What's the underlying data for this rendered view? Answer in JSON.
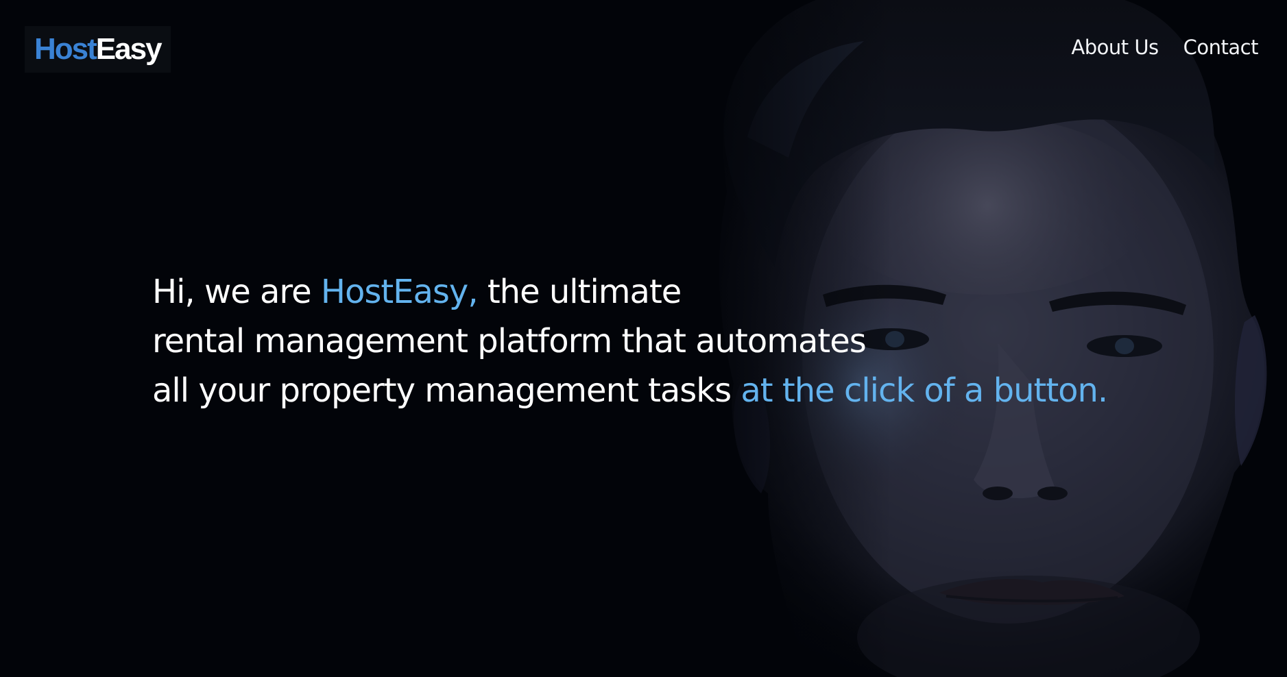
{
  "header": {
    "logo": {
      "part_primary": "Host",
      "part_secondary": "Easy"
    },
    "nav": [
      {
        "label": "About Us"
      },
      {
        "label": "Contact"
      }
    ]
  },
  "hero": {
    "line1": {
      "pre": "Hi, we are ",
      "brand": "HostEasy,",
      "post": " the ultimate"
    },
    "line2": "rental management platform that automates",
    "line3": {
      "pre": "all your property management tasks ",
      "accent": "at the click of a button."
    }
  },
  "colors": {
    "background": "#020409",
    "accent": "#63b3ee",
    "logo_primary": "#3a82d4",
    "text": "#ffffff"
  },
  "icons": [
    "portrait-background-image"
  ]
}
